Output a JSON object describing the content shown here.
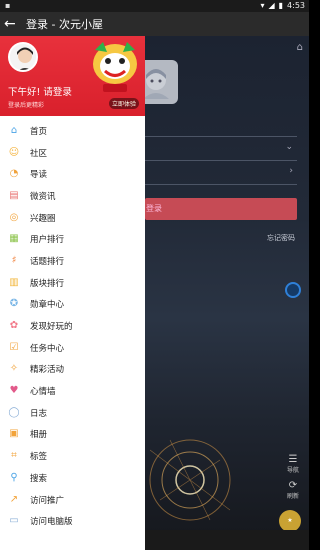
{
  "status_bar": {
    "time": "4:53"
  },
  "toolbar": {
    "title": "登录 - 次元小屋"
  },
  "drawer": {
    "greeting": "下午好! 请登录",
    "sub": "登录后更精彩",
    "promo": "立即体验",
    "menu": [
      {
        "label": "首页",
        "icon": "home-icon",
        "color": "#4aa3e6"
      },
      {
        "label": "社区",
        "icon": "community-icon",
        "color": "#f4b23a"
      },
      {
        "label": "导读",
        "icon": "guide-icon",
        "color": "#f0a23a"
      },
      {
        "label": "微资讯",
        "icon": "news-icon",
        "color": "#e8716f"
      },
      {
        "label": "兴趣圈",
        "icon": "interest-circle-icon",
        "color": "#f2a33a"
      },
      {
        "label": "用户排行",
        "icon": "user-rank-icon",
        "color": "#8bc34a"
      },
      {
        "label": "话题排行",
        "icon": "topic-rank-icon",
        "color": "#f0803a"
      },
      {
        "label": "版块排行",
        "icon": "board-rank-icon",
        "color": "#f2b63a"
      },
      {
        "label": "勋章中心",
        "icon": "medal-icon",
        "color": "#7ab6e6"
      },
      {
        "label": "发现好玩的",
        "icon": "discover-icon",
        "color": "#f27a8a"
      },
      {
        "label": "任务中心",
        "icon": "task-icon",
        "color": "#f2a33a"
      },
      {
        "label": "精彩活动",
        "icon": "activity-icon",
        "color": "#f0a23a"
      },
      {
        "label": "心情墙",
        "icon": "mood-wall-icon",
        "color": "#e25a8a"
      },
      {
        "label": "日志",
        "icon": "log-icon",
        "color": "#8aaed6"
      },
      {
        "label": "相册",
        "icon": "album-icon",
        "color": "#f2a33a"
      },
      {
        "label": "标签",
        "icon": "tag-icon",
        "color": "#f2a33a"
      },
      {
        "label": "搜索",
        "icon": "search-icon",
        "color": "#4aa3e6"
      },
      {
        "label": "访问推广",
        "icon": "share-icon",
        "color": "#f2a33a"
      },
      {
        "label": "访问电脑版",
        "icon": "desktop-icon",
        "color": "#8aaed6"
      }
    ]
  },
  "background_page": {
    "login_button": "登录",
    "forgot": "忘记密码",
    "nav_label": "导航",
    "refresh_label": "刷新"
  }
}
